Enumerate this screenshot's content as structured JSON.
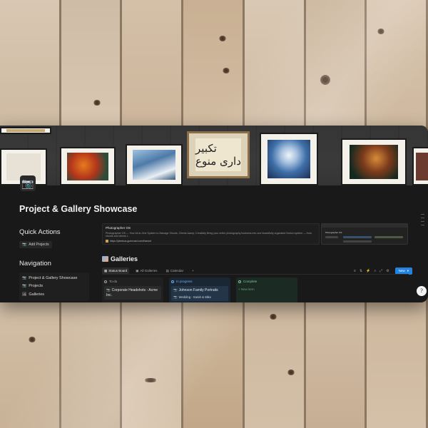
{
  "page": {
    "title": "Project & Gallery Showcase",
    "icon": "camera-icon"
  },
  "cover": {
    "calligraphy": "تکبیر داری منوع"
  },
  "quick_actions": {
    "heading": "Quick Actions",
    "add_projects": "Add Projects"
  },
  "navigation": {
    "heading": "Navigation",
    "items": [
      {
        "label": "Project & Gallery Showcase",
        "icon": "camera-icon"
      },
      {
        "label": "Projects",
        "icon": "camera-icon"
      },
      {
        "label": "Galleries",
        "icon": "image-icon"
      }
    ]
  },
  "info": {
    "title": "Photographer OS",
    "description": "Photographer OS — Your All-in-One System to Manage Shoots, Clients &amp; Creativity Bring your entire photography business into one beautifully organized Notion system — from shoots and clients t...",
    "link": "https://jdechua.gumroad.com/l/aewd",
    "preview_title": "Photographer OS"
  },
  "galleries": {
    "title": "Galleries",
    "views": [
      {
        "label": "Status Board",
        "active": true
      },
      {
        "label": "All Galleries",
        "active": false
      },
      {
        "label": "Calendar",
        "active": false
      }
    ],
    "add_view": "+",
    "new_button": "New",
    "columns": [
      {
        "name": "To-do",
        "cards": [
          {
            "title": "Corporate Headshots - Acme Inc."
          }
        ],
        "new_item": ""
      },
      {
        "name": "In progress",
        "cards": [
          {
            "title": "Johnson Family Portraits",
            "sub": "Wedding - Sarah & Mike"
          }
        ],
        "new_item": ""
      },
      {
        "name": "Complete",
        "cards": [],
        "new_item": "+ New item"
      }
    ]
  },
  "help": "?",
  "colors": {
    "accent": "#2383e2",
    "background": "#191919",
    "in_progress": "#6fb1f0",
    "complete": "#7fc79a"
  }
}
